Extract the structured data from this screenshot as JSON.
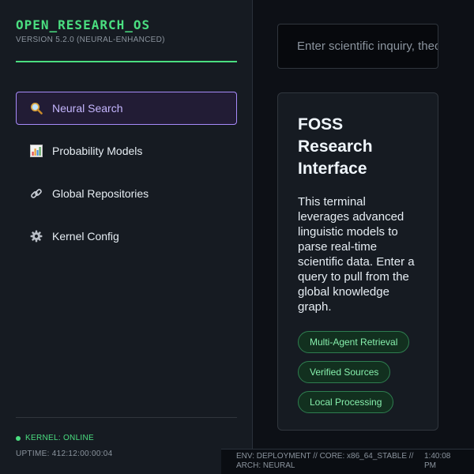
{
  "app": {
    "title": "OPEN_RESEARCH_OS",
    "version": "VERSION 5.2.0 (NEURAL-ENHANCED)"
  },
  "nav": {
    "items": [
      {
        "label": "Neural Search",
        "icon": "magnifier-icon",
        "active": true
      },
      {
        "label": "Probability Models",
        "icon": "bar-chart-icon",
        "active": false
      },
      {
        "label": "Global Repositories",
        "icon": "link-icon",
        "active": false
      },
      {
        "label": "Kernel Config",
        "icon": "gear-icon",
        "active": false
      }
    ]
  },
  "status": {
    "kernel": "KERNEL: ONLINE",
    "uptime": "UPTIME: 412:12:00:00:04"
  },
  "search": {
    "placeholder": "Enter scientific inquiry, theorem, or topic...",
    "value": ""
  },
  "card": {
    "title": "FOSS Research Interface",
    "body": "This terminal leverages advanced linguistic models to parse real-time scientific data. Enter a query to pull from the global knowledge graph.",
    "tags": [
      "Multi-Agent Retrieval",
      "Verified Sources",
      "Local Processing"
    ]
  },
  "statusbar": {
    "env": "ENV: DEPLOYMENT // CORE: x86_64_STABLE // ARCH: NEURAL",
    "time": "1:40:08 PM"
  },
  "colors": {
    "accent_green": "#4ade80",
    "accent_purple": "#a78bfa",
    "background": "#0d1016",
    "panel": "#161b22"
  }
}
